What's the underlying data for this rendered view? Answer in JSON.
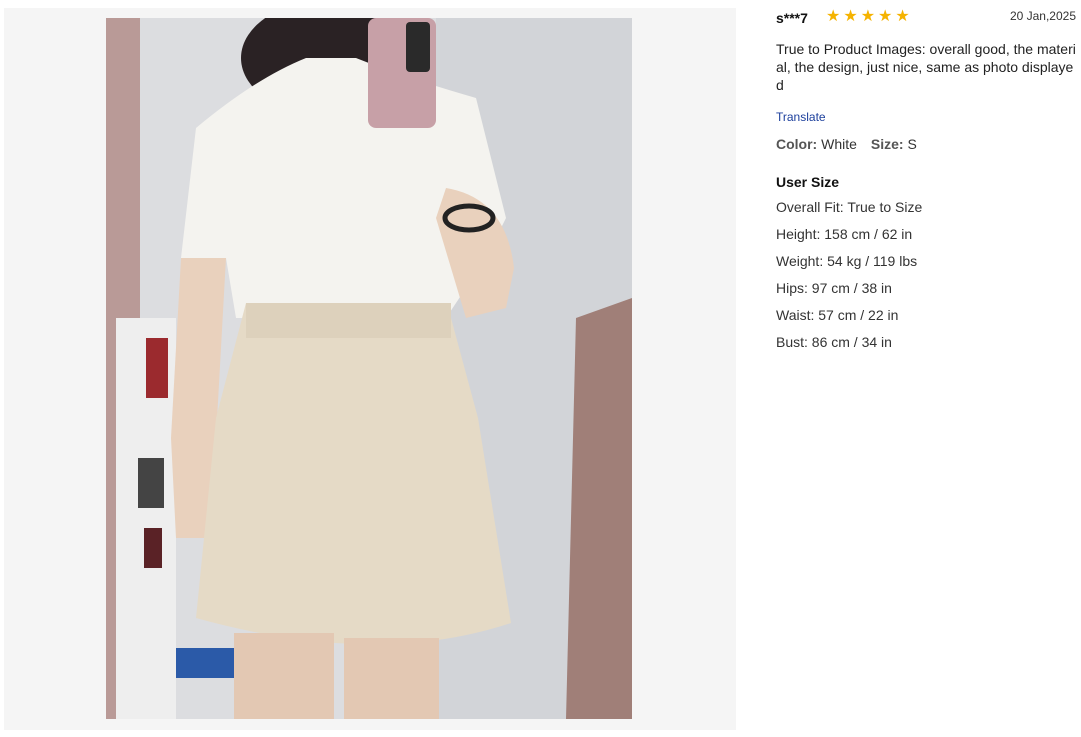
{
  "review": {
    "user": "s***7",
    "rating": 5,
    "date": "20 Jan,2025",
    "comment": "True to Product Images: overall good, the material, the design, just nice, same as photo displayed",
    "translate_label": "Translate",
    "color_label": "Color:",
    "color_value": "White",
    "size_label": "Size:",
    "size_value": "S"
  },
  "user_size": {
    "title": "User Size",
    "items": [
      {
        "label": "Overall Fit:",
        "value": "True to Size"
      },
      {
        "label": "Height:",
        "value": "158 cm / 62 in"
      },
      {
        "label": "Weight:",
        "value": "54 kg / 119 lbs"
      },
      {
        "label": "Hips:",
        "value": "97 cm / 38 in"
      },
      {
        "label": "Waist:",
        "value": "57 cm / 22 in"
      },
      {
        "label": "Bust:",
        "value": "86 cm / 34 in"
      }
    ]
  },
  "colors": {
    "star": "#f5b301",
    "link": "#1c3f9c",
    "panel_bg": "#f5f5f5"
  }
}
